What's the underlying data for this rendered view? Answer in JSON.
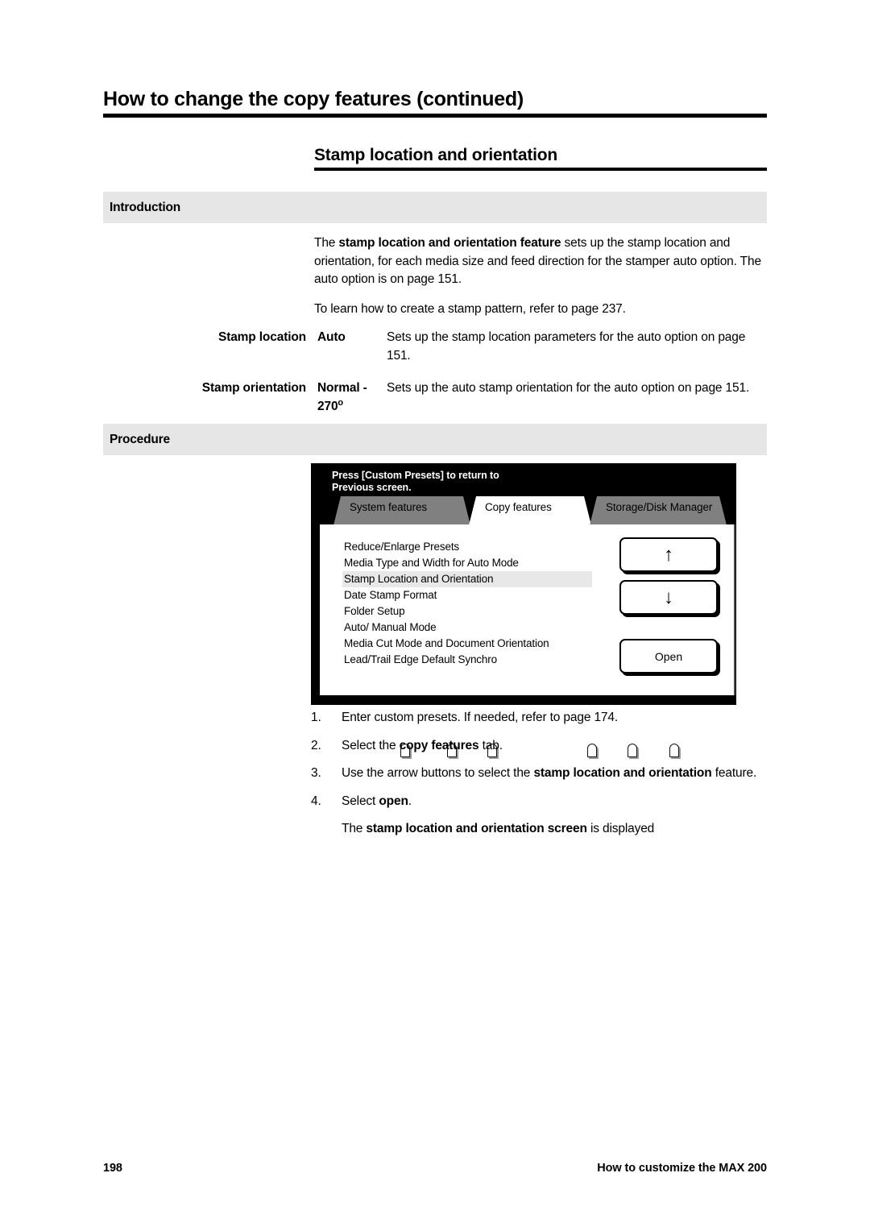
{
  "header": {
    "running_head": "How to change the copy features (continued)",
    "section_title": "Stamp location and orientation"
  },
  "introduction": {
    "heading": "Introduction",
    "paragraph_1_prefix": "The ",
    "paragraph_1_bold": "stamp location and orientation feature",
    "paragraph_1_suffix": " sets up the stamp location and orientation, for each media size and feed direction for the stamper auto option.  The auto option is on page 151.",
    "paragraph_2": "To learn how to create a stamp pattern, refer to page 237."
  },
  "definitions": [
    {
      "term": "Stamp location",
      "value": "Auto",
      "description": "Sets up the stamp location parameters for the auto option on page 151."
    },
    {
      "term": "Stamp orientation",
      "value_line_1": "Normal -",
      "value_line_2": "270",
      "value_degree": "o",
      "description": "Sets up the auto stamp orientation for the auto option on page 151."
    }
  ],
  "procedure": {
    "heading": "Procedure"
  },
  "device_screen": {
    "message_line_1": "Press [Custom Presets] to return to",
    "message_line_2": "Previous screen.",
    "tabs": [
      {
        "label": "System features",
        "active": false
      },
      {
        "label": "Copy features",
        "active": true
      },
      {
        "label": "Storage/Disk Manager",
        "active": false
      }
    ],
    "menu_items": [
      {
        "label": "Reduce/Enlarge Presets",
        "selected": false
      },
      {
        "label": "Media Type and Width for Auto Mode",
        "selected": false
      },
      {
        "label": "Stamp Location and Orientation",
        "selected": true
      },
      {
        "label": "Date Stamp Format",
        "selected": false
      },
      {
        "label": "Folder Setup",
        "selected": false
      },
      {
        "label": "Auto/ Manual Mode",
        "selected": false
      },
      {
        "label": "Media Cut Mode and Document Orientation",
        "selected": false
      },
      {
        "label": "Lead/Trail Edge Default Synchro",
        "selected": false
      }
    ],
    "buttons": {
      "up": "↑",
      "down": "↓",
      "open": "Open"
    },
    "hardware_key_positions": [
      100,
      158,
      208,
      332,
      382,
      434
    ]
  },
  "steps": [
    {
      "number": "1.",
      "plain_1": "Enter custom presets.  If needed, refer to page 174.",
      "bold": "",
      "plain_2": ""
    },
    {
      "number": "2.",
      "plain_1": "Select the ",
      "bold": "copy features",
      "plain_2": " tab."
    },
    {
      "number": "3.",
      "plain_1": "Use the arrow buttons to select the ",
      "bold": "stamp location and orientation",
      "plain_2": " feature."
    },
    {
      "number": "4.",
      "plain_1": "Select ",
      "bold": "open",
      "plain_2": "."
    }
  ],
  "result": {
    "plain_1": "The ",
    "bold": "stamp location and orientation screen",
    "plain_2": " is displayed"
  },
  "footer": {
    "page_number": "198",
    "book_title": "How to customize the MAX 200"
  },
  "colors": {
    "band_gray": "#e6e6e6",
    "tab_gray": "#808080",
    "highlight_gray": "#e8e8e8",
    "screen_black": "#000000"
  }
}
